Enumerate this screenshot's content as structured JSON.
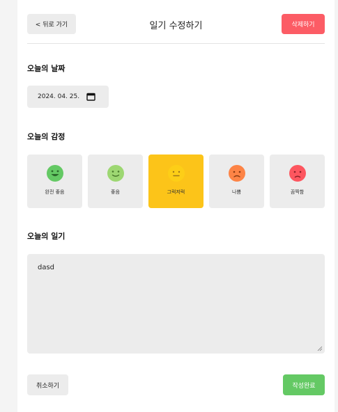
{
  "header": {
    "back_label": "< 뒤로 가기",
    "title": "일기 수정하기",
    "delete_label": "삭제하기"
  },
  "date_section": {
    "title": "오늘의 날짜",
    "date_value": "2024. 04. 25."
  },
  "emotion_section": {
    "title": "오늘의 감정",
    "items": [
      {
        "label": "완전 좋음",
        "color": "#64c964",
        "mood": "big-smile"
      },
      {
        "label": "좋음",
        "color": "#9dd772",
        "mood": "smile"
      },
      {
        "label": "그럭저럭",
        "color": "#fdce17",
        "mood": "neutral"
      },
      {
        "label": "나쁨",
        "color": "#fd8446",
        "mood": "frown"
      },
      {
        "label": "끔찍함",
        "color": "#fd565f",
        "mood": "sad"
      }
    ],
    "selected_index": 2
  },
  "diary_section": {
    "title": "오늘의 일기",
    "content": "dasd"
  },
  "footer": {
    "cancel_label": "취소하기",
    "done_label": "작성완료"
  }
}
